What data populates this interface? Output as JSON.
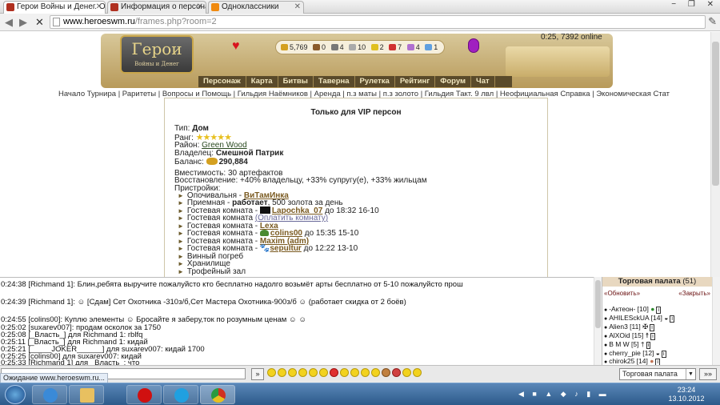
{
  "browser": {
    "tabs": [
      {
        "label": "Герои Войны и Денег. Он",
        "color": "#b03020"
      },
      {
        "label": "Информация о персона",
        "color": "#b03020"
      },
      {
        "label": "Одноклассники",
        "color": "#f08a10"
      }
    ],
    "url_host": "www.heroeswm.ru",
    "url_path": "/frames.php?room=2",
    "window_controls": "− ❐ ✕"
  },
  "header": {
    "logo_title": "Герои",
    "logo_subtitle": "Войны и Денег",
    "resources": [
      {
        "value": "5,769",
        "icon": "gold-icon",
        "color": "#d4a020"
      },
      {
        "value": "0",
        "icon": "wood-icon",
        "color": "#8a5a2a"
      },
      {
        "value": "4",
        "icon": "ore-icon",
        "color": "#777777"
      },
      {
        "value": "10",
        "icon": "mercury-icon",
        "color": "#aaaaaa"
      },
      {
        "value": "2",
        "icon": "sulfur-icon",
        "color": "#e0c020"
      },
      {
        "value": "7",
        "icon": "crystal-icon",
        "color": "#d03030"
      },
      {
        "value": "4",
        "icon": "gems-icon",
        "color": "#b070d0"
      },
      {
        "value": "1",
        "icon": "diamond-icon",
        "color": "#60a0e0"
      }
    ],
    "online": "0:25, 7392 online"
  },
  "menu": [
    "Персонаж",
    "Карта",
    "Битвы",
    "Таверна",
    "Рулетка",
    "Рейтинг",
    "Форум",
    "Чат"
  ],
  "links": "Начало Турнира | Раритеты | Вопросы и Помощь | Гильдия Наёмников | Аренда | п.з маты | п.з золото | Гильдия Такт. 9 лвл | Неофициальная Справка | Экономическая Стат",
  "house": {
    "title": "Только для VIP персон",
    "type_label": "Тип:",
    "type_value": "Дом",
    "rank_label": "Ранг:",
    "rank_stars": "★★★★★",
    "district_label": "Район:",
    "district_value": "Green Wood",
    "owner_label": "Владелец:",
    "owner_value": "Смешной Патрик",
    "balance_label": "Баланс:",
    "balance_value": "290,884",
    "capacity": "Вместимость: 30 артефактов",
    "restore": "Восстановление: +40% владельцу, +33% супругу(е), +33% жильцам",
    "annexes_label": "Пристройки:",
    "rooms": [
      {
        "name": "Опочивальня - ",
        "link": "ВиТамИнка",
        "extra": ""
      },
      {
        "name": "Приемная - ",
        "bold": "работает",
        "extra": ", 500 золота за день"
      },
      {
        "name": "Гостевая комната - ",
        "link": "Lapochka_07",
        "extra": " до 18:32 16-10"
      },
      {
        "name": "Гостевая комната ",
        "pay": "(Оплатить комнату)",
        "extra": ""
      },
      {
        "name": "Гостевая комната - ",
        "link": "Lexa",
        "extra": ""
      },
      {
        "name": "Гостевая комната - ",
        "link": "colins00",
        "extra": " до 15:35 15-10"
      },
      {
        "name": "Гостевая комната - ",
        "link": "Maxim (adm)",
        "extra": ""
      },
      {
        "name": "Гостевая комната - ",
        "link": "sepultur",
        "extra": " до 12:22 13-10"
      },
      {
        "name": "Винный погреб",
        "extra": ""
      },
      {
        "name": "Хранилище",
        "extra": ""
      },
      {
        "name": "Трофейный зал",
        "extra": ""
      }
    ]
  },
  "chat": [
    {
      "time": "0:24:38",
      "text": "[Richmand 1]: Блин,ребята выручите пожалуйсто кто бесплатно надолго возьмёт арты бесплатно от 5-10 пожалуйсто прош"
    },
    {
      "time": "0:24:39",
      "text": "[Richmand 1]: ☺ [Сдам] Сет Охотника -310з/б,Сет Мастера Охотника-900з/б ☺ (работает скидка от 2 боёв)"
    },
    {
      "time": "0:24:55",
      "text": "[colins00]: Куплю элементы ☺ Бросайте я заберу,ток по розумным ценам ☺ ☺"
    },
    {
      "time": "0:25:02",
      "text": "[suxarev007]: продам осколок за 1750"
    },
    {
      "time": "0:25:08",
      "text": "[_Власть_] для Richmand 1: rblfq"
    },
    {
      "time": "0:25:11",
      "text": "[_Власть_] для Richmand 1: кидай"
    },
    {
      "time": "0:25:21",
      "text": "[_____JOKER______] для suxarev007: кидай 1700"
    },
    {
      "time": "0:25:25",
      "text": "[colins00] для suxarev007: кидай"
    },
    {
      "time": "0:25:33",
      "text": "[Richmand 1] для _Власть_: что"
    }
  ],
  "sidebar": {
    "title": "Торговая палата",
    "count": "(51)",
    "refresh": "«Обновить»",
    "close": "«Закрыть»",
    "users": [
      {
        "name": "-Актеон- [10]",
        "icon": "leaf-icon"
      },
      {
        "name": "AHILESckUA [14]",
        "icon": "helmet-icon"
      },
      {
        "name": "Alien3 [11]",
        "icon": "cross-icon"
      },
      {
        "name": "AlXOid [15]",
        "icon": "figure-icon"
      },
      {
        "name": "B M W [5]",
        "icon": "sword-icon"
      },
      {
        "name": "cherry_pie [12]",
        "icon": "helmet-icon"
      },
      {
        "name": "chirok25 [14]",
        "icon": "pig-icon"
      }
    ]
  },
  "input": {
    "send_label": "»",
    "channel": "Торговая палата",
    "go_label": "»»"
  },
  "status_bar": "Ожидание www.heroeswm.ru...",
  "taskbar": {
    "time": "23:24",
    "date": "13.10.2012"
  }
}
